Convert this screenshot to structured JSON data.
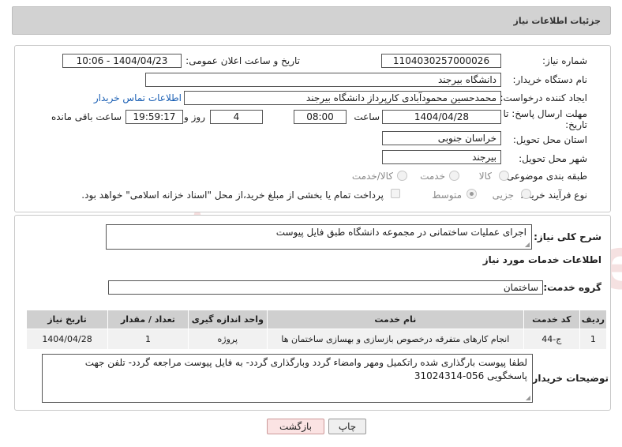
{
  "header": {
    "title": "جزئیات اطلاعات نیاز"
  },
  "form": {
    "need_number_label": "شماره نیاز:",
    "need_number": "1104030257000026",
    "announce_label": "تاریخ و ساعت اعلان عمومی:",
    "announce_value": "1404/04/23 - 10:06",
    "buyer_org_label": "نام دستگاه خریدار:",
    "buyer_org": "دانشگاه بیرجند",
    "creator_label": "ایجاد کننده درخواست:",
    "creator": "محمدحسین محمودآبادی کارپرداز دانشگاه بیرجند",
    "contact_link": "اطلاعات تماس خریدار",
    "deadline_label_1": "مهلت ارسال پاسخ: تا",
    "deadline_label_2": "تاریخ:",
    "deadline_date": "1404/04/28",
    "time_label": "ساعت",
    "deadline_time": "08:00",
    "days_value": "4",
    "days_label": "روز و",
    "remaining_time": "19:59:17",
    "remaining_label": "ساعت باقی مانده",
    "province_label": "استان محل تحویل:",
    "province": "خراسان جنوبی",
    "city_label": "شهر محل تحویل:",
    "city": "بیرجند",
    "category_label": "طبقه بندی موضوعی:",
    "category_options": [
      "کالا",
      "خدمت",
      "کالا/خدمت"
    ],
    "process_label": "نوع فرآیند خرید :",
    "process_options": [
      "جزیی",
      "متوسط"
    ],
    "payment_note": "پرداخت تمام یا بخشی از مبلغ خرید،از محل \"اسناد خزانه اسلامی\" خواهد بود."
  },
  "summary": {
    "label": "شرح کلی نیاز:",
    "text": "اجرای عملیات ساختمانی در مجموعه دانشگاه طبق فایل پیوست"
  },
  "services": {
    "section_title": "اطلاعات خدمات مورد نیاز",
    "group_label": "گروه خدمت:",
    "group_value": "ساختمان",
    "columns": [
      "ردیف",
      "کد خدمت",
      "نام خدمت",
      "واحد اندازه گیری",
      "تعداد / مقدار",
      "تاریخ نیاز"
    ],
    "rows": [
      [
        "1",
        "ج-44",
        "انجام کارهای متفرقه درخصوص بازسازی و بهسازی ساختمان ها",
        "پروژه",
        "1",
        "1404/04/28"
      ]
    ]
  },
  "buyer_notes": {
    "label": "توضیحات خریدار:",
    "text": "لطفا پیوست بارگذاری شده راتکمیل ومهر وامضاء گردد وبارگذاری گردد- به فایل پیوست مراجعه گردد- تلفن جهت پاسخگویی 056-31024314"
  },
  "buttons": {
    "print": "چاپ",
    "back": "بازگشت"
  },
  "watermark": {
    "text": "AriaTender.neT",
    "color": "#e9b7b7"
  }
}
